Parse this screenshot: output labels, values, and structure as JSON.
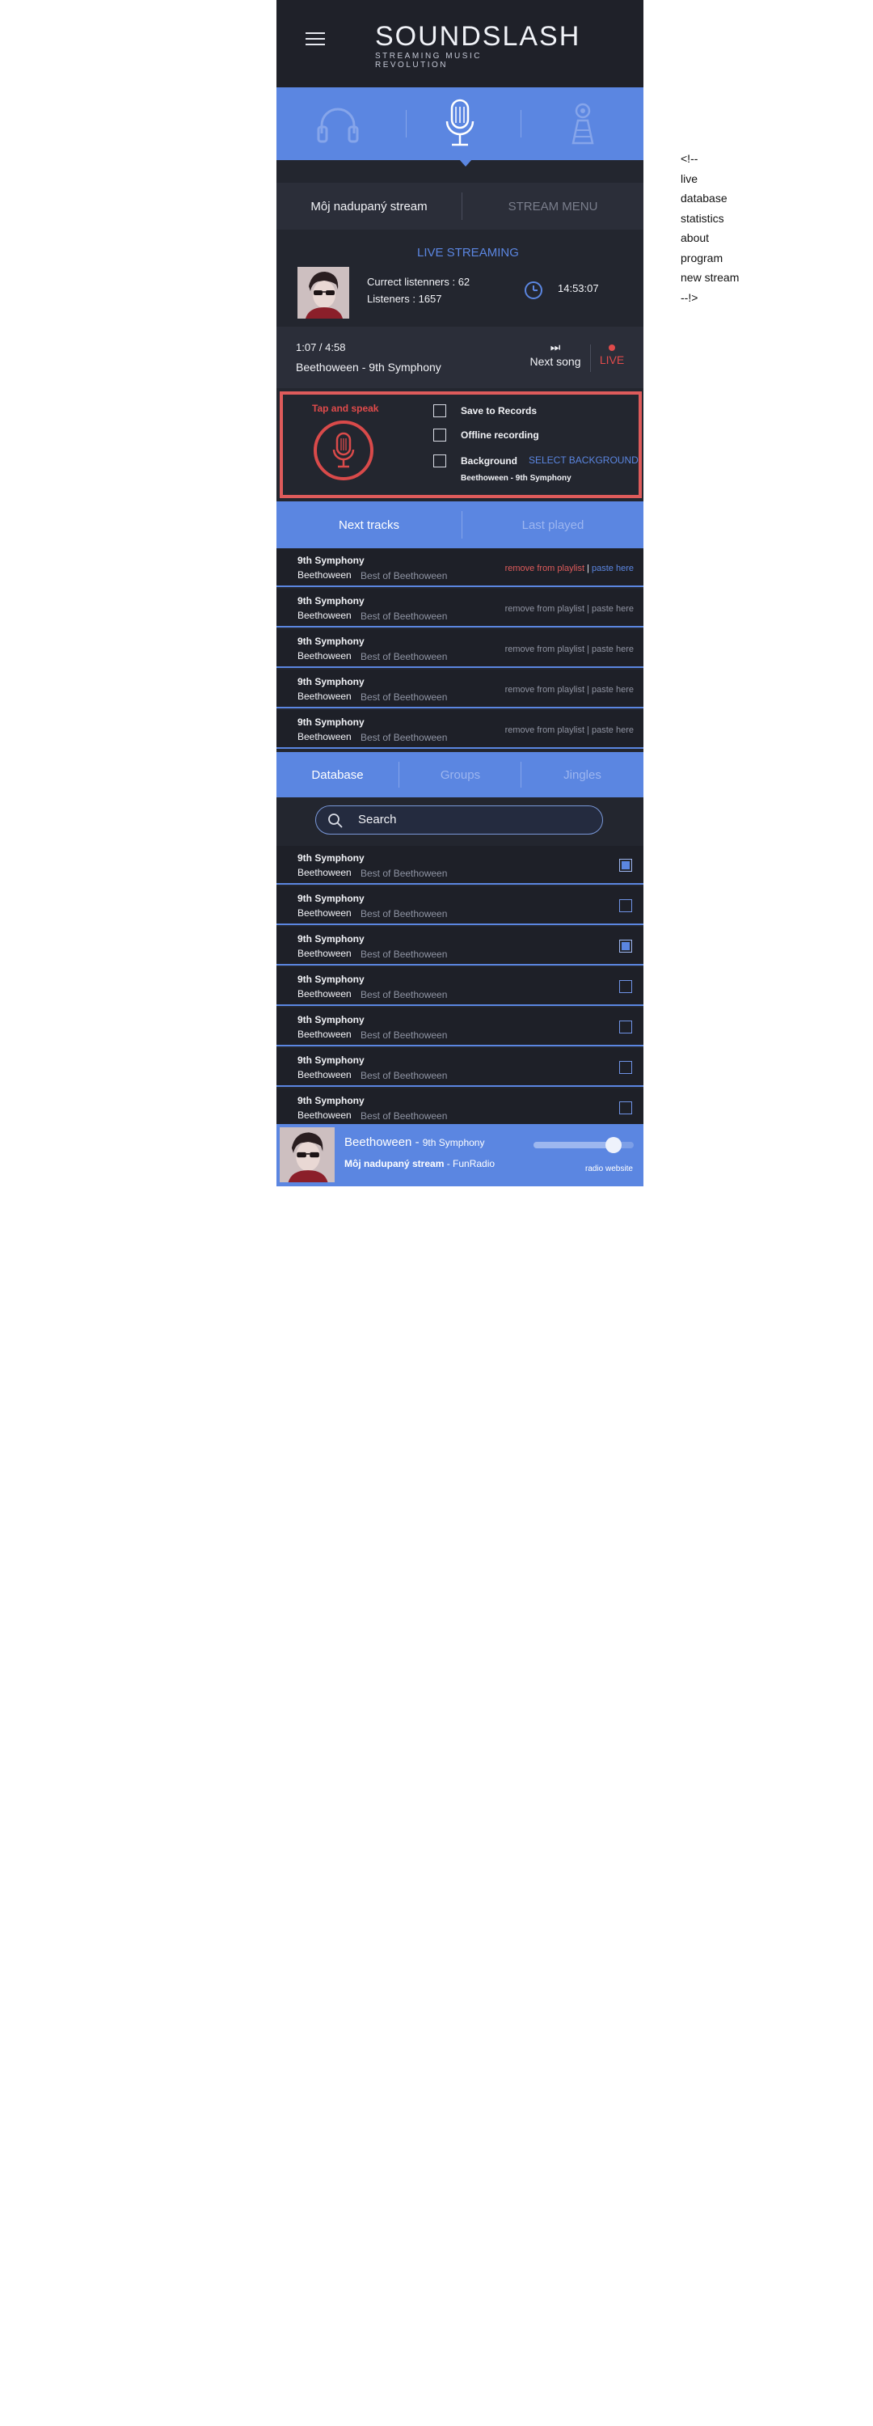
{
  "comment_lines": [
    "<!--",
    "live",
    "database",
    "statistics",
    "about",
    "program",
    "new stream",
    "--!>"
  ],
  "header": {
    "logo_title": "SOUNDSLASH",
    "logo_subtitle": "STREAMING MUSIC REVOLUTION",
    "menu_icon": "hamburger-icon"
  },
  "modes": {
    "items": [
      {
        "icon": "headphones-icon",
        "active": false
      },
      {
        "icon": "microphone-icon",
        "active": true
      },
      {
        "icon": "broadcast-tower-icon",
        "active": false
      }
    ]
  },
  "stream_tabs": {
    "active_label": "Môj nadupaný stream",
    "menu_label": "STREAM MENU"
  },
  "live": {
    "title": "LIVE STREAMING",
    "current_listeners": "Currect listenners : 62",
    "listeners": "Listeners : 1657",
    "time": "14:53:07"
  },
  "now_playing": {
    "progress": "1:07 / 4:58",
    "title": "Beethoween - 9th Symphony",
    "next_label": "Next song",
    "live_label": "LIVE"
  },
  "recorder": {
    "tap_label": "Tap and speak",
    "options": [
      {
        "label": "Save to Records",
        "checked": false
      },
      {
        "label": "Offline recording",
        "checked": false
      },
      {
        "label": "Background",
        "checked": false
      }
    ],
    "select_background": "SELECT BACKGROUND",
    "background_track": "Beethoween - 9th Symphony"
  },
  "track_tabs": {
    "next": "Next tracks",
    "last": "Last played"
  },
  "next_tracks": [
    {
      "title": "9th Symphony",
      "artist": "Beethoween",
      "album": "Best of Beethoween",
      "remove": "remove from playlist",
      "sep": " | ",
      "paste": "paste here",
      "highlight": true
    },
    {
      "title": "9th Symphony",
      "artist": "Beethoween",
      "album": "Best of Beethoween",
      "remove": "remove from playlist",
      "sep": " | ",
      "paste": "paste here",
      "highlight": false
    },
    {
      "title": "9th Symphony",
      "artist": "Beethoween",
      "album": "Best of Beethoween",
      "remove": "remove from playlist",
      "sep": " | ",
      "paste": "paste here",
      "highlight": false
    },
    {
      "title": "9th Symphony",
      "artist": "Beethoween",
      "album": "Best of Beethoween",
      "remove": "remove from playlist",
      "sep": " | ",
      "paste": "paste here",
      "highlight": false
    },
    {
      "title": "9th Symphony",
      "artist": "Beethoween",
      "album": "Best of Beethoween",
      "remove": "remove from playlist",
      "sep": " | ",
      "paste": "paste here",
      "highlight": false
    }
  ],
  "db_tabs": {
    "database": "Database",
    "groups": "Groups",
    "jingles": "Jingles"
  },
  "search": {
    "placeholder": "Search",
    "value": ""
  },
  "database_rows": [
    {
      "title": "9th Symphony",
      "artist": "Beethoween",
      "album": "Best of Beethoween",
      "checked": true
    },
    {
      "title": "9th Symphony",
      "artist": "Beethoween",
      "album": "Best of Beethoween",
      "checked": false
    },
    {
      "title": "9th Symphony",
      "artist": "Beethoween",
      "album": "Best of Beethoween",
      "checked": true
    },
    {
      "title": "9th Symphony",
      "artist": "Beethoween",
      "album": "Best of Beethoween",
      "checked": false
    },
    {
      "title": "9th Symphony",
      "artist": "Beethoween",
      "album": "Best of Beethoween",
      "checked": false
    },
    {
      "title": "9th Symphony",
      "artist": "Beethoween",
      "album": "Best of Beethoween",
      "checked": false
    },
    {
      "title": "9th Symphony",
      "artist": "Beethoween",
      "album": "Best of Beethoween",
      "checked": false
    }
  ],
  "player": {
    "artist": "Beethoween",
    "dash": " - ",
    "track": "9th Symphony",
    "stream": "Môj nadupaný stream",
    "station_sep": " - ",
    "station": "FunRadio",
    "radio_site": "radio website",
    "volume": 0.8
  },
  "colors": {
    "accent": "#5b86e1",
    "live_red": "#e04b4b",
    "panel_dark": "#23262f"
  }
}
